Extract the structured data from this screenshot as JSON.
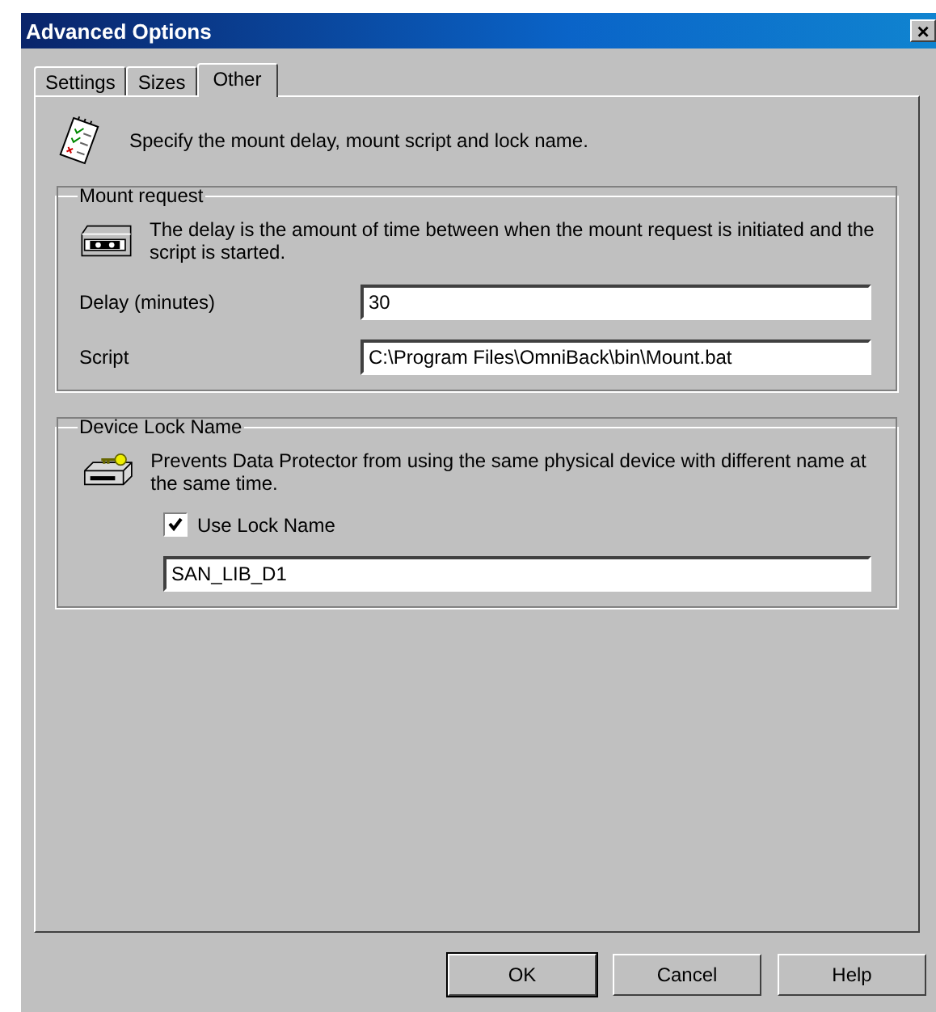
{
  "window": {
    "title": "Advanced Options",
    "close": "×"
  },
  "tabs": [
    {
      "label": "Settings",
      "selected": false
    },
    {
      "label": "Sizes",
      "selected": false
    },
    {
      "label": "Other",
      "selected": true
    }
  ],
  "intro": "Specify the mount delay, mount script and lock name.",
  "mount_request": {
    "title": "Mount request",
    "description": "The delay is the amount of time between when the mount request is initiated and the script is started.",
    "fields": [
      {
        "label": "Delay (minutes)",
        "value": "30"
      },
      {
        "label": "Script",
        "value": "C:\\Program Files\\OmniBack\\bin\\Mount.bat"
      }
    ]
  },
  "device_lock": {
    "title": "Device Lock Name",
    "description": "Prevents Data Protector from using the same physical device with different name at the same time.",
    "checkbox": {
      "label": "Use Lock Name",
      "checked": true
    },
    "value": "SAN_LIB_D1"
  },
  "buttons": [
    {
      "label": "OK",
      "default": true
    },
    {
      "label": "Cancel",
      "default": false
    },
    {
      "label": "Help",
      "default": false
    }
  ]
}
